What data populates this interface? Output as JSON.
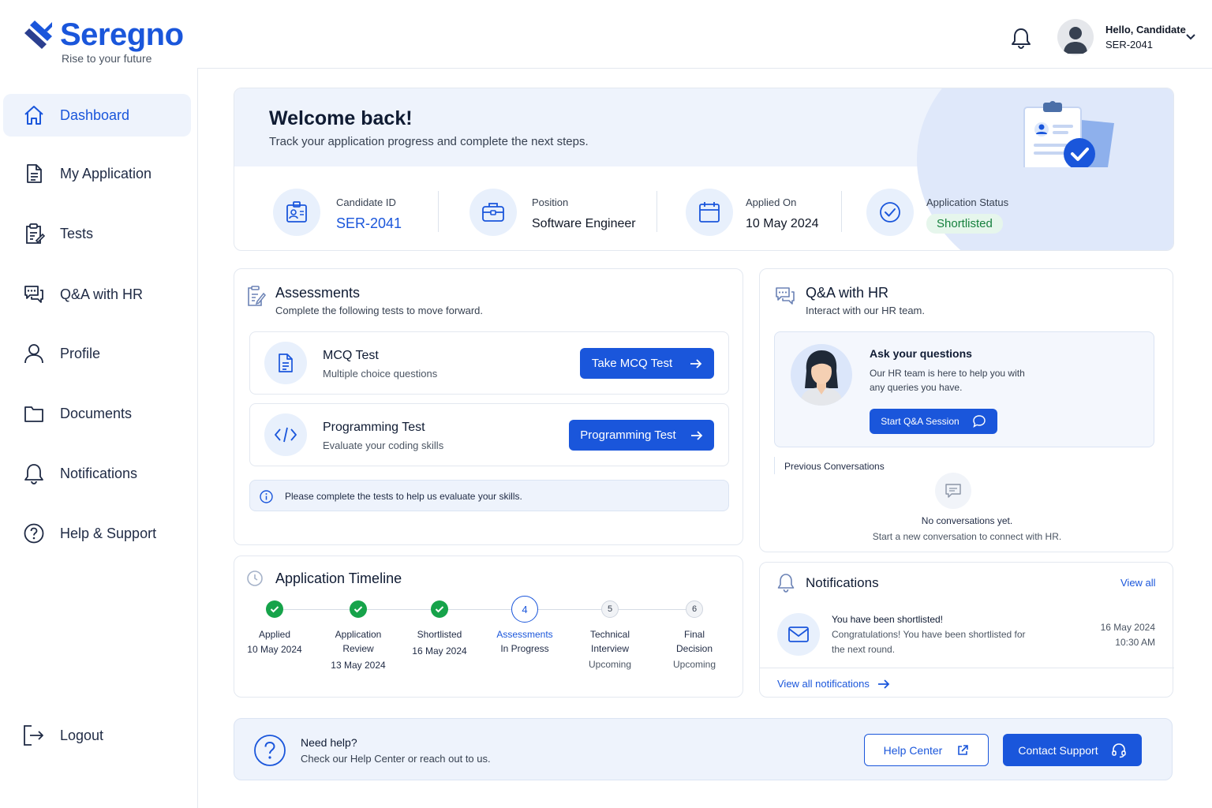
{
  "brand": {
    "name": "Seregno",
    "tagline": "Rise to your future",
    "accent": "#1a56db"
  },
  "user": {
    "greeting": "Hello, Candidate",
    "id": "SER-2041"
  },
  "sidebar": {
    "items": [
      {
        "label": "Dashboard",
        "icon": "home-icon",
        "active": true
      },
      {
        "label": "My Application",
        "icon": "document-icon"
      },
      {
        "label": "Tests",
        "icon": "clipboard-icon"
      },
      {
        "label": "Q&A with HR",
        "icon": "chat-icon"
      },
      {
        "label": "Profile",
        "icon": "user-icon"
      },
      {
        "label": "Documents",
        "icon": "folder-icon"
      },
      {
        "label": "Notifications",
        "icon": "bell-icon"
      },
      {
        "label": "Help & Support",
        "icon": "help-icon"
      }
    ],
    "logout": "Logout"
  },
  "welcome": {
    "title": "Welcome back!",
    "subtitle": "Track your application progress and complete the next steps.",
    "stats": [
      {
        "label": "Candidate ID",
        "value": "SER-2041"
      },
      {
        "label": "Position",
        "value": "Software Engineer"
      },
      {
        "label": "Applied On",
        "value": "10 May 2024"
      },
      {
        "label": "Application Status",
        "value": "Shortlisted"
      }
    ]
  },
  "assessments": {
    "title": "Assessments",
    "subtitle": "Complete the following tests to move forward.",
    "tests": [
      {
        "title": "MCQ Test",
        "desc": "Multiple choice questions",
        "button": "Take MCQ Test"
      },
      {
        "title": "Programming Test",
        "desc": "Evaluate your coding skills",
        "button": "Programming Test"
      }
    ],
    "info": "Please complete the tests to help us evaluate your skills."
  },
  "qa": {
    "title": "Q&A with HR",
    "subtitle": "Interact with our HR team.",
    "ask_title": "Ask your questions",
    "ask_desc_1": "Our HR team is here to help you with",
    "ask_desc_2": "any queries you have.",
    "button": "Start Q&A Session",
    "previous": "Previous Conversations",
    "empty_title": "No conversations yet.",
    "empty_desc": "Start a new conversation to connect with HR."
  },
  "timeline": {
    "title": "Application Timeline",
    "steps": [
      {
        "marker": "",
        "line1": "Applied",
        "line2": "",
        "sub": "10 May 2024",
        "state": "done"
      },
      {
        "marker": "",
        "line1": "Application",
        "line2": "Review",
        "sub": "13 May 2024",
        "state": "done"
      },
      {
        "marker": "",
        "line1": "Shortlisted",
        "line2": "",
        "sub": "16 May 2024",
        "state": "done"
      },
      {
        "marker": "4",
        "line1": "Assessments",
        "line2": "",
        "sub": "In Progress",
        "state": "current"
      },
      {
        "marker": "5",
        "line1": "Technical",
        "line2": "Interview",
        "sub": "Upcoming",
        "state": "upcoming"
      },
      {
        "marker": "6",
        "line1": "Final",
        "line2": "Decision",
        "sub": "Upcoming",
        "state": "upcoming"
      }
    ]
  },
  "notifications": {
    "title": "Notifications",
    "view_all": "View all",
    "item": {
      "title": "You have been shortlisted!",
      "line1": "Congratulations! You have been shortlisted for",
      "line2": "the next round.",
      "date": "16 May 2024",
      "time": "10:30 AM"
    },
    "view_all_notifications": "View all notifications"
  },
  "help": {
    "title": "Need help?",
    "desc": "Check our Help Center or reach out to us.",
    "help_center": "Help Center",
    "contact": "Contact Support"
  },
  "colors": {
    "success": "#16a34a",
    "success_bg": "#e6f6ec",
    "light_blue": "#eef3fc"
  }
}
